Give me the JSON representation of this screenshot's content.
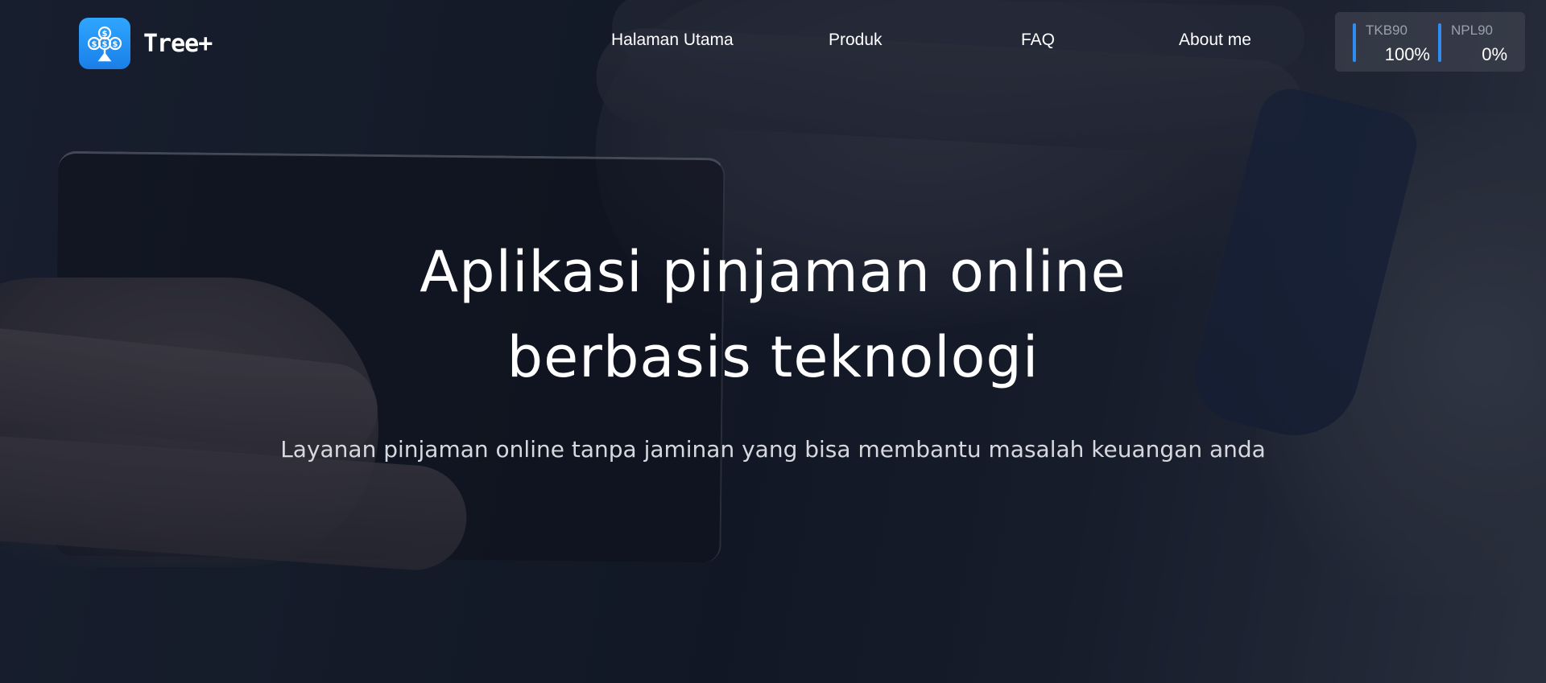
{
  "brand": {
    "name": "Tree+",
    "logo_icon": "money-tree-icon",
    "accent_color": "#1f8ef1"
  },
  "nav": {
    "items": [
      {
        "label": "Halaman Utama"
      },
      {
        "label": "Produk"
      },
      {
        "label": "FAQ"
      },
      {
        "label": "About me"
      }
    ]
  },
  "stats": [
    {
      "label": "TKB90",
      "value": "100%"
    },
    {
      "label": "NPL90",
      "value": "0%"
    }
  ],
  "hero": {
    "headline_line1": "Aplikasi pinjaman online",
    "headline_line2": "berbasis teknologi",
    "subtitle": "Layanan pinjaman online tanpa jaminan yang bisa membantu masalah keuangan anda"
  }
}
